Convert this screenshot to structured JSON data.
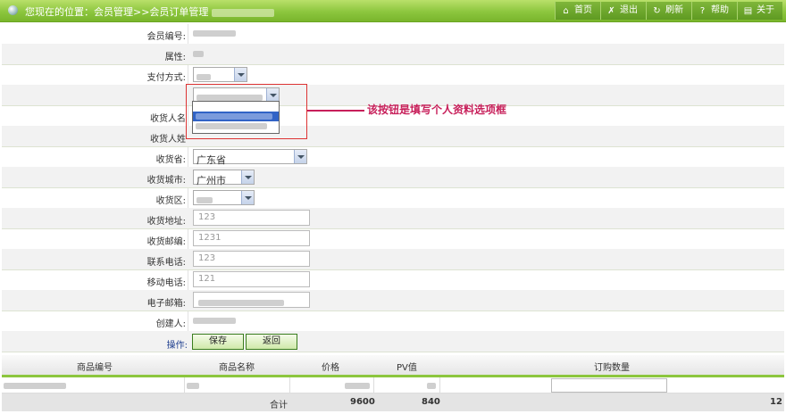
{
  "header": {
    "breadcrumb": "您现在的位置：会员管理>>会员订单管理",
    "nav": [
      {
        "label": "首页",
        "icon": "home-icon"
      },
      {
        "label": "退出",
        "icon": "exit-icon"
      },
      {
        "label": "刷新",
        "icon": "refresh-icon"
      },
      {
        "label": "帮助",
        "icon": "help-icon"
      },
      {
        "label": "关于",
        "icon": "about-icon"
      }
    ]
  },
  "form": {
    "member_no_label": "会员编号:",
    "attr_label": "属性:",
    "payment_label": "支付方式:",
    "receiver_name_label": "收货人名",
    "receiver_surname_label": "收货人姓",
    "province_label": "收货省:",
    "province_value": "广东省",
    "city_label": "收货城市:",
    "city_value": "广州市",
    "district_label": "收货区:",
    "address_label": "收货地址:",
    "address_value": "123",
    "zip_label": "收货邮编:",
    "zip_value": "1231",
    "phone_label": "联系电话:",
    "phone_value": "123",
    "mobile_label": "移动电话:",
    "mobile_value": "121",
    "email_label": "电子邮箱:",
    "creator_label": "创建人:",
    "operation_label": "操作:",
    "save_button": "保存",
    "back_button": "返回"
  },
  "callout": "该按钮是填写个人资料选项框",
  "products": {
    "headers": [
      "商品编号",
      "商品名称",
      "价格",
      "PV值",
      "订购数量"
    ],
    "total_label": "合计",
    "total_price": "9600",
    "total_pv": "840",
    "total_qty": "12"
  },
  "colors": {
    "accent": "#8cc63e",
    "callout": "#c71f5a"
  }
}
